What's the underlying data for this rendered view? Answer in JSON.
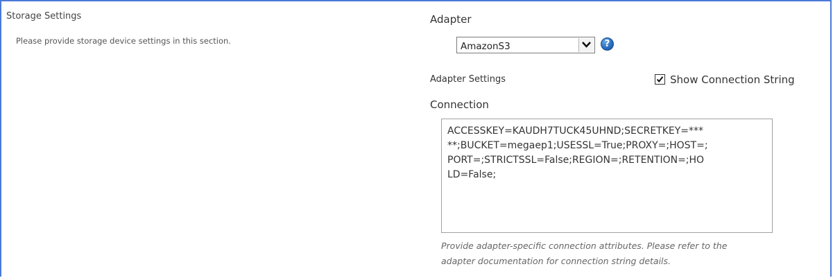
{
  "section": {
    "title": "Storage Settings",
    "description": "Please provide storage device settings in this section."
  },
  "adapter": {
    "label": "Adapter",
    "selected": "AmazonS3",
    "help_icon": "question-circle-icon",
    "dropdown_icon": "chevron-down-icon"
  },
  "adapter_settings": {
    "label": "Adapter Settings",
    "show_connection_string": {
      "label": "Show Connection String",
      "checked": true
    }
  },
  "connection": {
    "label": "Connection",
    "value_lines": [
      "ACCESSKEY=KAUDH7TUCK45UHND;SECRETKEY=***",
      "**;BUCKET=megaep1;USESSL=True;PROXY=;HOST=;",
      "PORT=;STRICTSSL=False;REGION=;RETENTION=;HO",
      "LD=False;"
    ],
    "hint_lines": [
      "Provide adapter-specific connection attributes. Please refer to the",
      "adapter documentation for connection string details."
    ]
  },
  "colors": {
    "frame_border": "#4a7ad8",
    "help_icon": "#2a6fc0"
  }
}
